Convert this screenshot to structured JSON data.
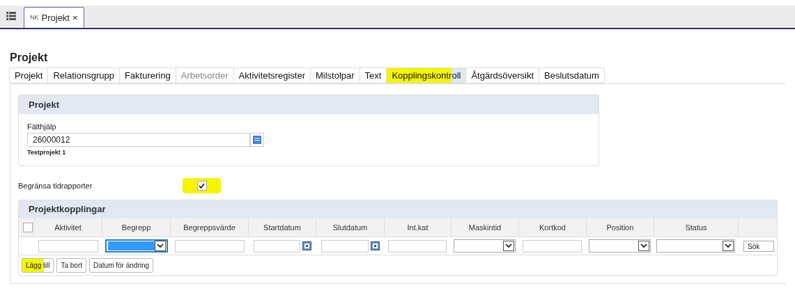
{
  "app_tabs": [
    {
      "badge": "NK",
      "label": "Projekt",
      "close": "×",
      "selected": true
    }
  ],
  "page_title": "Projekt",
  "tabs": [
    {
      "label": "Projekt",
      "selected": false,
      "disabled": false,
      "highlighted": false
    },
    {
      "label": "Relationsgrupp",
      "selected": false,
      "disabled": false,
      "highlighted": false
    },
    {
      "label": "Fakturering",
      "selected": false,
      "disabled": false,
      "highlighted": false
    },
    {
      "label": "Arbetsorder",
      "selected": false,
      "disabled": true,
      "highlighted": false
    },
    {
      "label": "Aktivitetsregister",
      "selected": false,
      "disabled": false,
      "highlighted": false
    },
    {
      "label": "Milstolpar",
      "selected": false,
      "disabled": false,
      "highlighted": false
    },
    {
      "label": "Text",
      "selected": false,
      "disabled": false,
      "highlighted": false
    },
    {
      "label": "Kopplingskontroll",
      "selected": true,
      "disabled": false,
      "highlighted": true
    },
    {
      "label": "Åtgärdsöversikt",
      "selected": false,
      "disabled": false,
      "highlighted": false
    },
    {
      "label": "Beslutsdatum",
      "selected": false,
      "disabled": false,
      "highlighted": false
    }
  ],
  "project_card": {
    "title": "Projekt",
    "field_label": "Fälthjälp",
    "value": "26000012",
    "description": "Testprojekt 1"
  },
  "restrict": {
    "label": "Begränsa tidrapporter",
    "checked": true,
    "highlighted": true
  },
  "couplings": {
    "title": "Projektkopplingar",
    "select_all": {
      "checked": false
    },
    "columns": [
      "Aktivitet",
      "Begrepp",
      "Begreppsvärde",
      "Startdatum",
      "Slutdatum",
      "Int.kat",
      "Maskintid",
      "Kortkod",
      "Position",
      "Status"
    ],
    "filters": [
      {
        "kind": "text",
        "active": false
      },
      {
        "kind": "select",
        "active": true
      },
      {
        "kind": "text",
        "active": false
      },
      {
        "kind": "date",
        "active": false
      },
      {
        "kind": "date",
        "active": false
      },
      {
        "kind": "text",
        "active": false
      },
      {
        "kind": "select",
        "active": false
      },
      {
        "kind": "text",
        "active": false
      },
      {
        "kind": "select",
        "active": false
      },
      {
        "kind": "select",
        "active": false
      }
    ],
    "search_button": "Sök",
    "buttons": [
      {
        "label": "Lägg till",
        "highlighted": true
      },
      {
        "label": "Ta bort",
        "highlighted": false
      },
      {
        "label": "Datum för ändring",
        "highlighted": false
      }
    ]
  }
}
